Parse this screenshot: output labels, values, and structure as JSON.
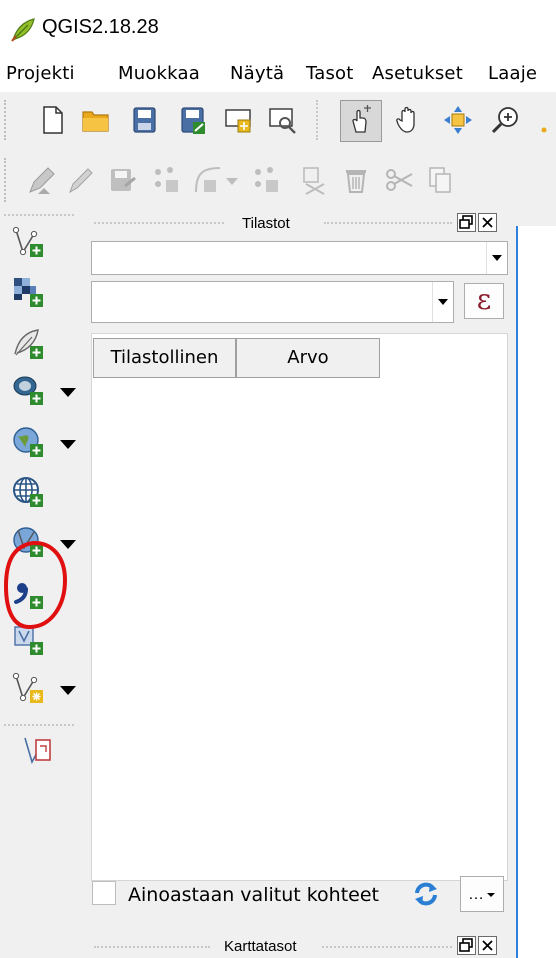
{
  "window": {
    "title": "QGIS2.18.28",
    "logo": "qgis-leaf-icon"
  },
  "menu": [
    {
      "label": "Projekti"
    },
    {
      "label": "Muokkaa"
    },
    {
      "label": "Näytä"
    },
    {
      "label": "Tasot"
    },
    {
      "label": "Asetukset"
    },
    {
      "label": "Laaje"
    }
  ],
  "toolbar_file": [
    "new-project-icon",
    "open-folder-icon",
    "save-icon",
    "save-as-icon",
    "new-print-composer-icon",
    "composer-manager-icon"
  ],
  "toolbar_map": [
    "identify-touch-icon",
    "pan-hand-icon",
    "pan-to-selection-icon",
    "zoom-in-icon"
  ],
  "toolbar_edit": [
    "current-edits-icon",
    "toggle-editing-icon",
    "save-edits-icon",
    "add-feature-icon",
    "node-tool-icon",
    "add-part-icon",
    "delete-part-icon",
    "delete-selected-icon",
    "cut-features-icon",
    "copy-features-icon"
  ],
  "left_toolbar": [
    {
      "icon": "add-vector-layer-icon",
      "dropdown": false
    },
    {
      "icon": "add-raster-layer-icon",
      "dropdown": false
    },
    {
      "icon": "add-spatialite-layer-icon",
      "dropdown": false
    },
    {
      "icon": "add-postgis-layer-icon",
      "dropdown": true
    },
    {
      "icon": "add-wms-layer-icon",
      "dropdown": true
    },
    {
      "icon": "add-wfs-layer-icon",
      "dropdown": false
    },
    {
      "icon": "add-wcs-layer-icon",
      "dropdown": true
    },
    {
      "icon": "add-delimited-text-layer-icon",
      "dropdown": false
    },
    {
      "icon": "add-virtual-layer-icon",
      "dropdown": false
    },
    {
      "icon": "new-shapefile-layer-icon",
      "dropdown": true
    },
    {
      "icon": "georeferencer-icon",
      "dropdown": false
    }
  ],
  "stats_panel": {
    "title": "Tilastot",
    "layer_combo_value": "",
    "field_combo_value": "",
    "expression_button": "ε",
    "columns": [
      "Tilastollinen",
      "Arvo"
    ],
    "rows": [],
    "selected_only_label": "Ainoastaan valitut kohteet",
    "selected_only_checked": false,
    "more_button": "…"
  },
  "next_panel": {
    "title": "Karttatasot"
  },
  "annotation": {
    "color": "#e01010",
    "target": "add-delimited-text-layer-icon"
  },
  "colors": {
    "accent_blue": "#3080e0",
    "plus_green": "#2e8b2e",
    "epsilon": "#8a1c2c"
  }
}
